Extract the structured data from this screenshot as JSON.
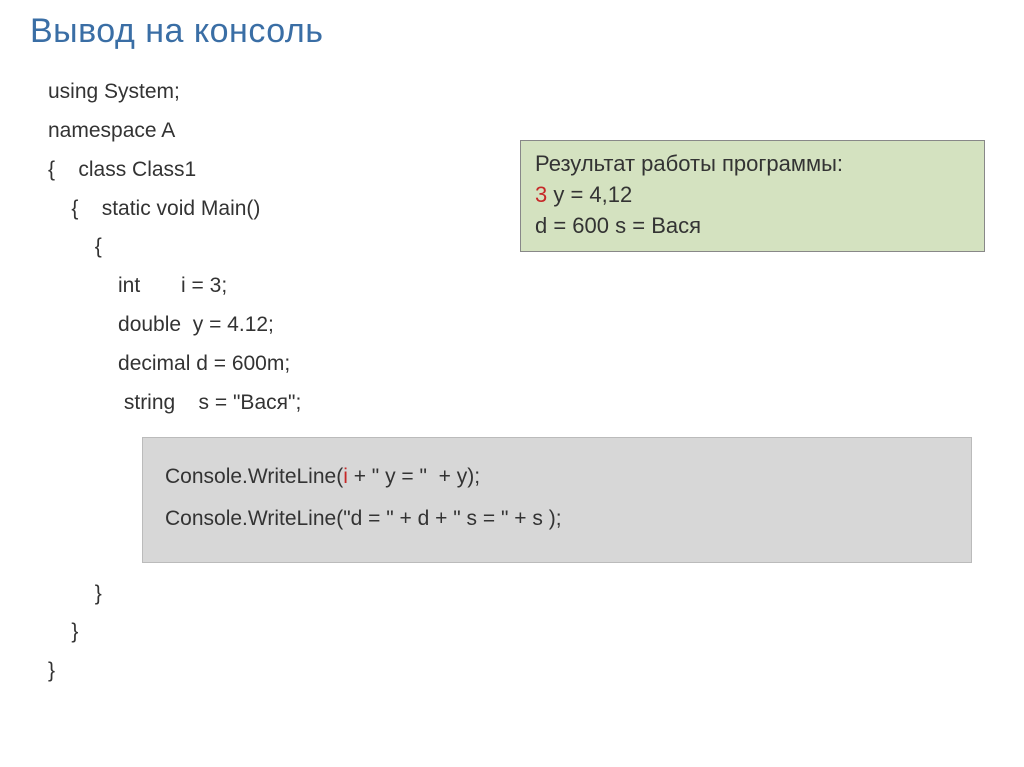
{
  "title": "Вывод на консоль",
  "code": {
    "l1": "using System;",
    "l2": "namespace A",
    "l3a": "{",
    "l3b": "class Class1",
    "l4a": "{",
    "l4b": "static void Main()",
    "l5": "{",
    "l6": "int       i = 3;",
    "l7": "double  y = 4.12;",
    "l8": "decimal d = 600m;",
    "l9": "string    s = \"Вася\";",
    "h1a": "Console.WriteLine(",
    "h1b": "i",
    "h1c": " + \" y = \"  + y);",
    "h2": "Console.WriteLine(\"d = \" + d + \" s = \" + s );",
    "l10": "}",
    "l11": "}",
    "l12": "}"
  },
  "result": {
    "label": "Результат работы программы:",
    "line2a": "3",
    "line2b": " y = 4,12",
    "line3": "d = 600 s = Вася"
  }
}
